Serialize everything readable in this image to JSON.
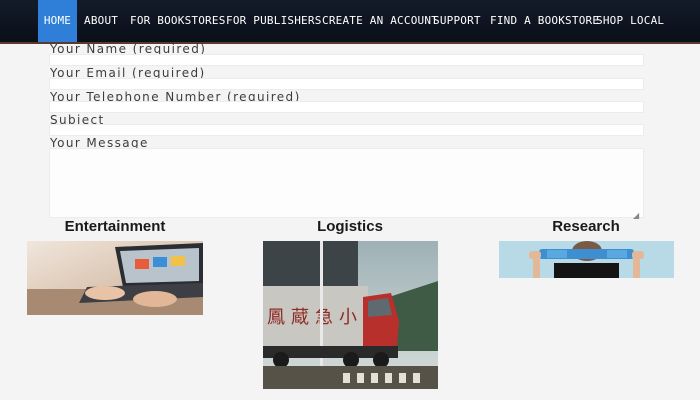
{
  "nav": {
    "items": [
      {
        "label": "HOME",
        "active": true
      },
      {
        "label": "ABOUT"
      },
      {
        "label": "FOR BOOKSTORES"
      },
      {
        "label": "FOR PUBLISHERS"
      },
      {
        "label": "CREATE AN ACCOUNT"
      },
      {
        "label": "SUPPORT"
      },
      {
        "label": "FIND A BOOKSTORE"
      },
      {
        "label": "SHOP LOCAL"
      }
    ],
    "active_color": "#2f7fd8"
  },
  "form": {
    "name_label": "Your Name (required)",
    "email_label": "Your Email (required)",
    "phone_label": "Your Telephone Number (required)",
    "subject_label": "Subject",
    "message_label": "Your Message"
  },
  "categories": [
    {
      "title": "Entertainment",
      "image": "laptop-hands-image"
    },
    {
      "title": "Logistics",
      "image": "truck-image"
    },
    {
      "title": "Research",
      "image": "person-with-blueprints-image"
    }
  ]
}
